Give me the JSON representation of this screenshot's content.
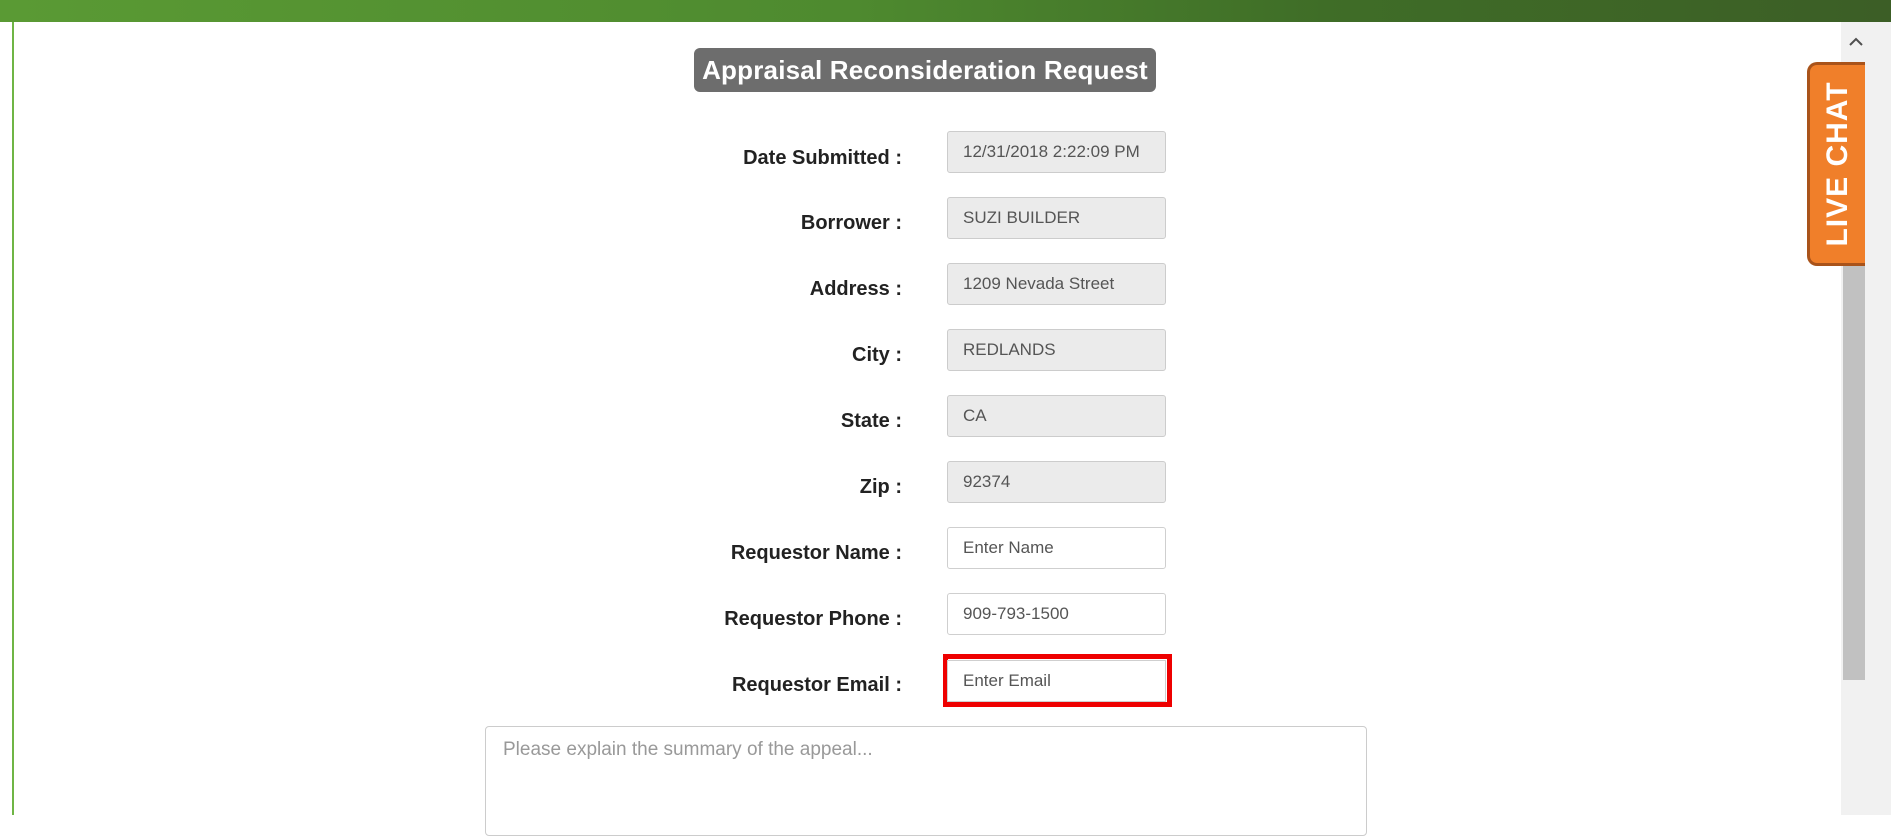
{
  "header": {
    "title": "Appraisal Reconsideration Request"
  },
  "form": {
    "rows": [
      {
        "label": "Date Submitted :",
        "value": "12/31/2018 2:22:09 PM",
        "readonly": true
      },
      {
        "label": "Borrower :",
        "value": "SUZI BUILDER",
        "readonly": true
      },
      {
        "label": "Address :",
        "value": "1209 Nevada Street",
        "readonly": true
      },
      {
        "label": "City :",
        "value": "REDLANDS",
        "readonly": true
      },
      {
        "label": "State :",
        "value": "CA",
        "readonly": true
      },
      {
        "label": "Zip :",
        "value": "92374",
        "readonly": true
      },
      {
        "label": "Requestor Name :",
        "placeholder": "Enter Name",
        "value": ""
      },
      {
        "label": "Requestor Phone :",
        "value": "909-793-1500"
      },
      {
        "label": "Requestor Email :",
        "placeholder": "Enter Email",
        "value": ""
      }
    ],
    "summary_placeholder": "Please explain the summary of the appeal..."
  },
  "live_chat": {
    "label": "LIVE CHAT"
  },
  "scrollbar": {
    "up_icon": "chevron-up-icon"
  },
  "colors": {
    "header_green": "#5a9a34",
    "title_chip": "#6d6d6d",
    "live_chat_orange": "#f07f2a",
    "highlight_red": "#ee0000"
  }
}
